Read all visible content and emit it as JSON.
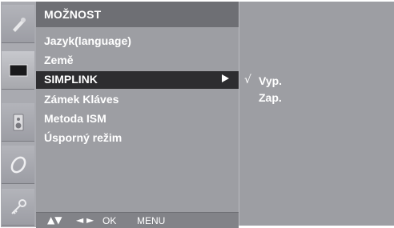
{
  "menu": {
    "title": "MOŽNOST",
    "items": [
      {
        "label": "Jazyk(language)"
      },
      {
        "label": "Země"
      },
      {
        "label": "SIMPLINK",
        "selected": true
      },
      {
        "label": "Zámek Kláves"
      },
      {
        "label": "Metoda ISM"
      },
      {
        "label": "Úsporný režim"
      }
    ]
  },
  "submenu": {
    "check_mark": "√",
    "options": [
      {
        "label": "Vyp.",
        "checked": true
      },
      {
        "label": "Zap."
      }
    ]
  },
  "help_bar": {
    "up_down": "▲▼",
    "left_right": "◄ ►",
    "ok": "OK",
    "menu": "MENU"
  },
  "icons": [
    "picture-icon",
    "screen-icon",
    "speaker-icon",
    "clock-icon",
    "key-icon"
  ],
  "colors": {
    "panel": "#9d9ea3",
    "title_bar": "#6e6f74",
    "selection": "#2d2d30",
    "text": "#ffffff"
  }
}
